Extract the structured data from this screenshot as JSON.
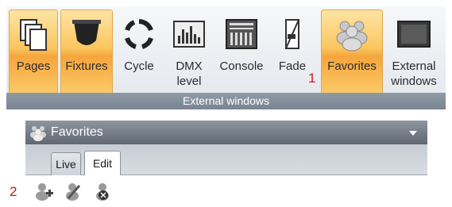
{
  "ribbon": {
    "buttons": [
      {
        "label": "Pages",
        "icon": "pages-icon",
        "active": true
      },
      {
        "label": "Fixtures",
        "icon": "fixtures-icon",
        "active": true
      },
      {
        "label": "Cycle",
        "icon": "cycle-icon",
        "active": false
      },
      {
        "label": "DMX level",
        "icon": "dmx-level-icon",
        "active": false
      },
      {
        "label": "Console",
        "icon": "console-icon",
        "active": false
      },
      {
        "label": "Fade",
        "icon": "fade-icon",
        "active": false
      },
      {
        "label": "Favorites",
        "icon": "favorites-icon",
        "active": true
      },
      {
        "label": "External windows",
        "icon": "external-windows-icon",
        "active": false
      }
    ],
    "group_caption": "External windows",
    "marker": "1"
  },
  "panel": {
    "title": "Favorites",
    "tabs": [
      {
        "label": "Live"
      },
      {
        "label": "Edit"
      }
    ],
    "active_tab": "Edit",
    "toolbar_icons": [
      "add-favorite-icon",
      "edit-favorite-icon",
      "delete-favorite-icon"
    ],
    "marker": "2"
  },
  "colors": {
    "active_button": "#fbc65e",
    "caption_bar": "#7a8592",
    "title_bar": "#5e6773",
    "marker_red": "#d01818"
  }
}
